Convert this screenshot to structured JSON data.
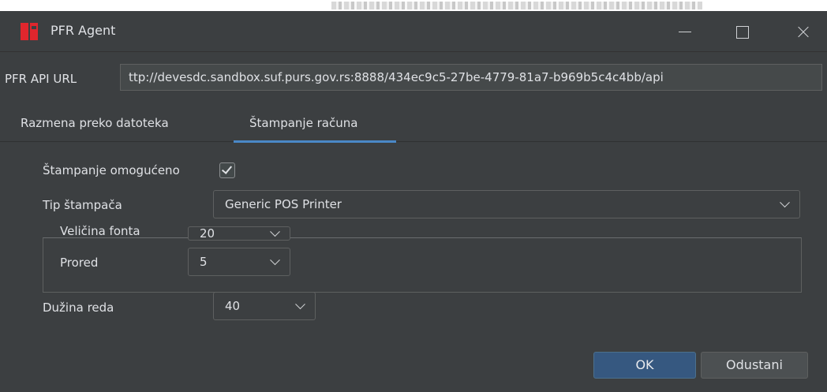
{
  "window": {
    "title": "PFR Agent"
  },
  "url": {
    "label": "PFR API URL",
    "value": "ttp://devesdc.sandbox.suf.purs.gov.rs:8888/434ec9c5-27be-4779-81a7-b969b5c4c4bb/api"
  },
  "tabs": [
    {
      "label": "Razmena preko datoteka",
      "active": false
    },
    {
      "label": "Štampanje računa",
      "active": true
    }
  ],
  "printing": {
    "enabled_label": "Štampanje omogućeno",
    "enabled": true,
    "printer_type_label": "Tip štampača",
    "printer_type_value": "Generic POS Printer",
    "font_size_label": "Veličina fonta",
    "font_size_value": "20",
    "line_spacing_label": "Prored",
    "line_spacing_value": "5",
    "line_length_label": "Dužina reda",
    "line_length_value": "40"
  },
  "buttons": {
    "ok": "OK",
    "cancel": "Odustani"
  },
  "colors": {
    "background": "#3c3f41",
    "accent": "#4a88c7",
    "ok_button": "#365880",
    "logo": "#e0262d"
  }
}
